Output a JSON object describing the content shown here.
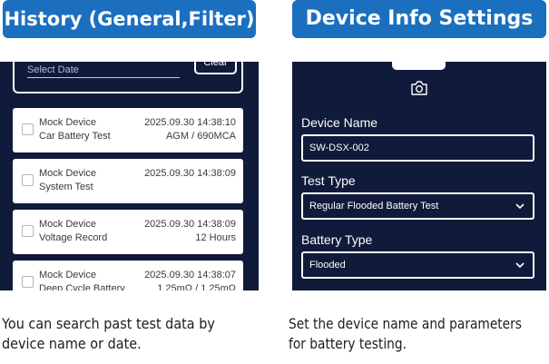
{
  "left_panel": {
    "title": "History (General,Filter)",
    "search": {
      "date_placeholder": "Select Date",
      "clear_label": "Clear"
    },
    "records": [
      {
        "device": "Mock Device",
        "test": "Car Battery Test",
        "time": "2025.09.30 14:38:10",
        "result": "AGM / 690MCA"
      },
      {
        "device": "Mock Device",
        "test": "System Test",
        "time": "2025.09.30 14:38:09",
        "result": ""
      },
      {
        "device": "Mock Device",
        "test": "Voltage Record",
        "time": "2025.09.30 14:38:09",
        "result": "12 Hours"
      },
      {
        "device": "Mock Device",
        "test": "Deep Cycle Battery",
        "time": "2025.09.30 14:38:07",
        "result": "1.25mΩ / 1.25mΩ"
      }
    ],
    "caption": [
      "You can search past test data by",
      "device name or date."
    ]
  },
  "right_panel": {
    "title": "Device Info Settings",
    "camera_icon": "camera-icon",
    "device_name": {
      "label": "Device Name",
      "value": "SW-DSX-002"
    },
    "test_type": {
      "label": "Test Type",
      "value": "Regular Flooded Battery Test"
    },
    "battery_type": {
      "label": "Battery Type",
      "value": "Flooded"
    },
    "caption": [
      "Set the device name and parameters",
      "for battery testing."
    ]
  },
  "colors": {
    "badge": "#1b6fbf",
    "screen": "#101a3a",
    "card": "#ffffff"
  }
}
